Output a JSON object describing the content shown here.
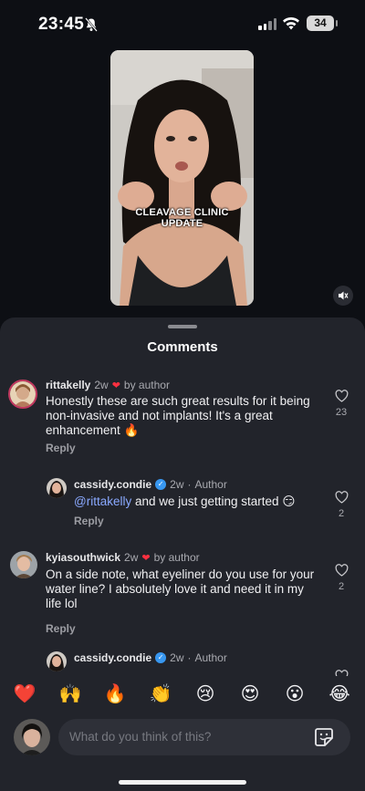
{
  "status_bar": {
    "time": "23:45",
    "battery": "34",
    "icons": [
      "bell-slash-icon",
      "signal-icon",
      "wifi-icon",
      "battery-icon"
    ]
  },
  "video": {
    "caption_line1": "CLEAVAGE CLINIC",
    "caption_line2": "UPDATE",
    "mute_icon": "speaker-muted-icon"
  },
  "sheet": {
    "title": "Comments"
  },
  "comments": [
    {
      "username": "rittakelly",
      "time": "2w",
      "badge": "by author",
      "text": "Honestly these are such great results for it being non-invasive and not implants! It's a great enhancement 🔥",
      "reply_label": "Reply",
      "likes": "23"
    },
    {
      "username": "cassidy.condie",
      "time": "2w",
      "badge": "Author",
      "mention": "@rittakelly",
      "text": " and we just getting started 😏",
      "reply_label": "Reply",
      "likes": "2"
    },
    {
      "username": "kyiasouthwick",
      "time": "2w",
      "badge": "by author",
      "text": "On a side note, what eyeliner do you use for your water line? I absolutely love it and need it in my life lol",
      "reply_label": "Reply",
      "likes": "2"
    },
    {
      "username": "cassidy.condie",
      "time": "2w",
      "badge": "Author"
    }
  ],
  "quick_reactions": [
    "❤️",
    "🙌",
    "🔥",
    "👏",
    "😢",
    "😍",
    "😮",
    "😂"
  ],
  "composer": {
    "placeholder": "What do you think of this?",
    "sticker_icon": "sticker-icon"
  },
  "colors": {
    "background": "#0d0f14",
    "sheet": "#22242b",
    "accent_heart": "#ff3040",
    "mention": "#8aa9ff",
    "verified": "#3897f0"
  }
}
